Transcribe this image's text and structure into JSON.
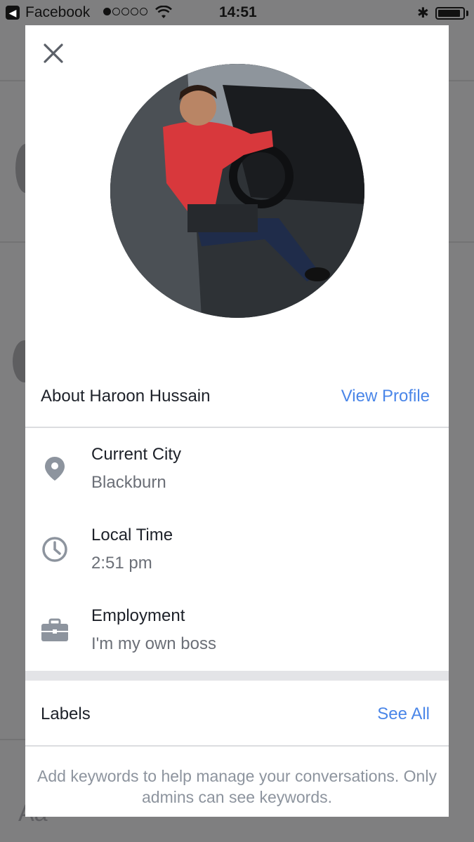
{
  "status_bar": {
    "back_app": "Facebook",
    "time": "14:51",
    "signal_dots": [
      1,
      0,
      0,
      0,
      0
    ],
    "battery_level": 0.9
  },
  "background": {
    "composer_placeholder": "Aa"
  },
  "modal": {
    "close_icon": "close-icon",
    "about_title": "About Haroon Hussain",
    "view_profile": "View Profile",
    "info": [
      {
        "icon": "location-pin-icon",
        "label": "Current City",
        "value": "Blackburn"
      },
      {
        "icon": "clock-icon",
        "label": "Local Time",
        "value": "2:51 pm"
      },
      {
        "icon": "briefcase-icon",
        "label": "Employment",
        "value": "I'm my own boss"
      }
    ],
    "labels_title": "Labels",
    "see_all": "See All",
    "hint": "Add keywords to help manage your conversations. Only admins can see keywords."
  },
  "colors": {
    "link": "#4a86e8",
    "icon_gray": "#8d949e",
    "overlay": "#7f7f80"
  }
}
